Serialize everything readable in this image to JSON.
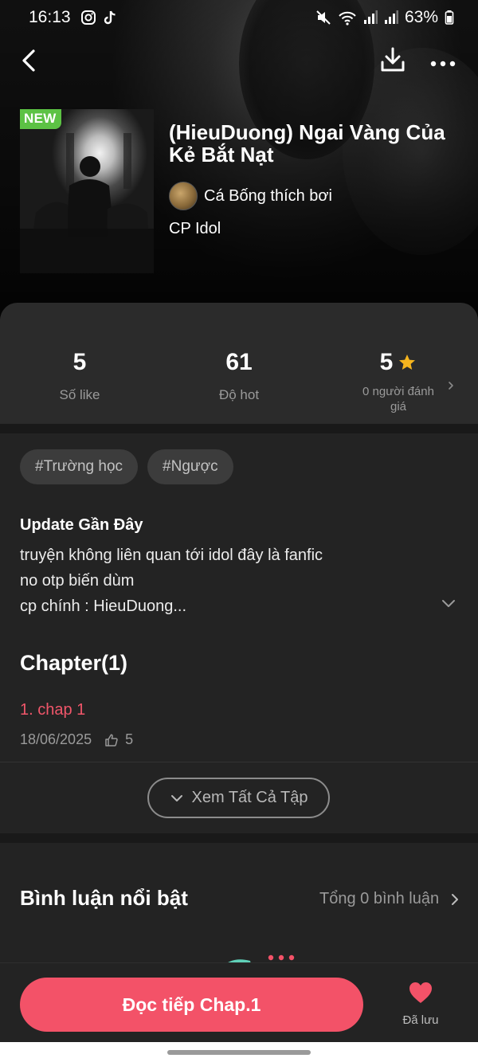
{
  "status_bar": {
    "time": "16:13",
    "battery": "63%"
  },
  "novel": {
    "badge": "NEW",
    "title": "(HieuDuong) Ngai Vàng Của Kẻ Bắt Nạt",
    "author": "Cá Bống thích bơi",
    "category": "CP Idol"
  },
  "stats": {
    "likes": {
      "value": "5",
      "label": "Số like"
    },
    "hot": {
      "value": "61",
      "label": "Độ hot"
    },
    "rating": {
      "value": "5",
      "label": "0 người đánh giá"
    }
  },
  "tags": [
    "#Trường học",
    "#Ngược"
  ],
  "update": {
    "title": "Update Gần Đây",
    "lines": [
      "truyện không liên quan tới idol đây là fanfic",
      "no otp biến dùm",
      "cp chính : HieuDuong..."
    ]
  },
  "chapters": {
    "heading": "Chapter(1)",
    "items": [
      {
        "title": "1. chap 1",
        "date": "18/06/2025",
        "likes": "5"
      }
    ],
    "view_all": "Xem Tất Cả Tập"
  },
  "comments": {
    "title": "Bình luận nổi bật",
    "total": "Tổng 0 bình luận"
  },
  "bottom": {
    "read_button": "Đọc tiếp Chap.1",
    "saved_label": "Đã lưu"
  },
  "colors": {
    "accent": "#f35268",
    "chapter_link": "#f0566a",
    "new_badge": "#5cc244",
    "star": "#f6b51e"
  },
  "icons": {
    "back": "chevron-left-icon",
    "download": "download-icon",
    "more": "more-horizontal-icon",
    "star": "star-icon",
    "heart": "heart-icon",
    "thumb": "thumbs-up-icon"
  }
}
